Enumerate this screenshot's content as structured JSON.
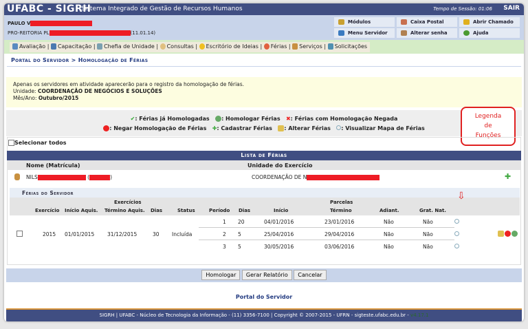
{
  "header": {
    "logo": "UFABC - SIGRH",
    "subtitle": "Sistema Integrado de Gestão de Recursos Humanos",
    "session_label": "Tempo de Sessão: 01:06",
    "logout": "SAIR"
  },
  "user": {
    "name": "PAULO V",
    "dept": "PRO-REITORIA PL",
    "dept_code": "(11.01.14)"
  },
  "quick": [
    "Módulos",
    "Caixa Postal",
    "Abrir Chamado",
    "Menu Servidor",
    "Alterar senha",
    "Ajuda"
  ],
  "menu": [
    "Avaliação",
    "Capacitação",
    "Chefia de Unidade",
    "Consultas",
    "Escritório de Ideias",
    "Férias",
    "Serviços",
    "Solicitações"
  ],
  "breadcrumb": "Portal do Servidor > Homologação de Férias",
  "info": {
    "line1": "Apenas os servidores em atividade aparecerão para o registro da homologação de férias.",
    "unit_label": "Unidade:",
    "unit": "COORDENAÇÃO DE NEGÓCIOS E SOLUÇÕES",
    "month_label": "Mês/Ano:",
    "month": "Outubro/2015"
  },
  "legend": [
    "Férias já Homologadas",
    "Homologar Férias",
    "Férias com Homologação Negada",
    "Negar Homologação de Férias",
    "Cadastrar Férias",
    "Alterar Férias",
    "Visualizar Mapa de Férias"
  ],
  "callout": [
    "Legenda",
    "de",
    "Funções"
  ],
  "select_all": "Selecionar todos",
  "list": {
    "title": "Lista de Férias",
    "col_name": "Nome (Matrícula)",
    "col_unit": "Unidade do Exercício",
    "employee": "NILS",
    "employee_paren_open": "(",
    "employee_paren_close": ")",
    "employee_unit": "COORDENAÇÃO DE N"
  },
  "ferias": {
    "title": "Férias do Servidor",
    "group_exercicios": "Exercícios",
    "group_parcelas": "Parcelas",
    "headers": [
      "Exercício",
      "Início Aquis.",
      "Término Aquis.",
      "Dias",
      "Status",
      "Período",
      "Dias",
      "Início",
      "Término",
      "Adiant.",
      "Grat. Nat."
    ],
    "exercise": {
      "year": "2015",
      "start": "01/01/2015",
      "end": "31/12/2015",
      "days": "30",
      "status": "Incluída"
    },
    "parcels": [
      {
        "period": "1",
        "days": "20",
        "start": "04/01/2016",
        "end": "23/01/2016",
        "adiant": "Não",
        "grat": "Não"
      },
      {
        "period": "2",
        "days": "5",
        "start": "25/04/2016",
        "end": "29/04/2016",
        "adiant": "Não",
        "grat": "Não"
      },
      {
        "period": "3",
        "days": "5",
        "start": "30/05/2016",
        "end": "03/06/2016",
        "adiant": "Não",
        "grat": "Não"
      }
    ]
  },
  "buttons": {
    "homologar": "Homologar",
    "relatorio": "Gerar Relatório",
    "cancelar": "Cancelar"
  },
  "portal_link": "Portal do Servidor",
  "footer": {
    "text": "SIGRH | UFABC - Núcleo de Tecnologia da Informação - (11) 3356-7100 | Copyright © 2007-2015 - UFRN - sigteste.ufabc.edu.br -",
    "version": "v4.17.1"
  }
}
